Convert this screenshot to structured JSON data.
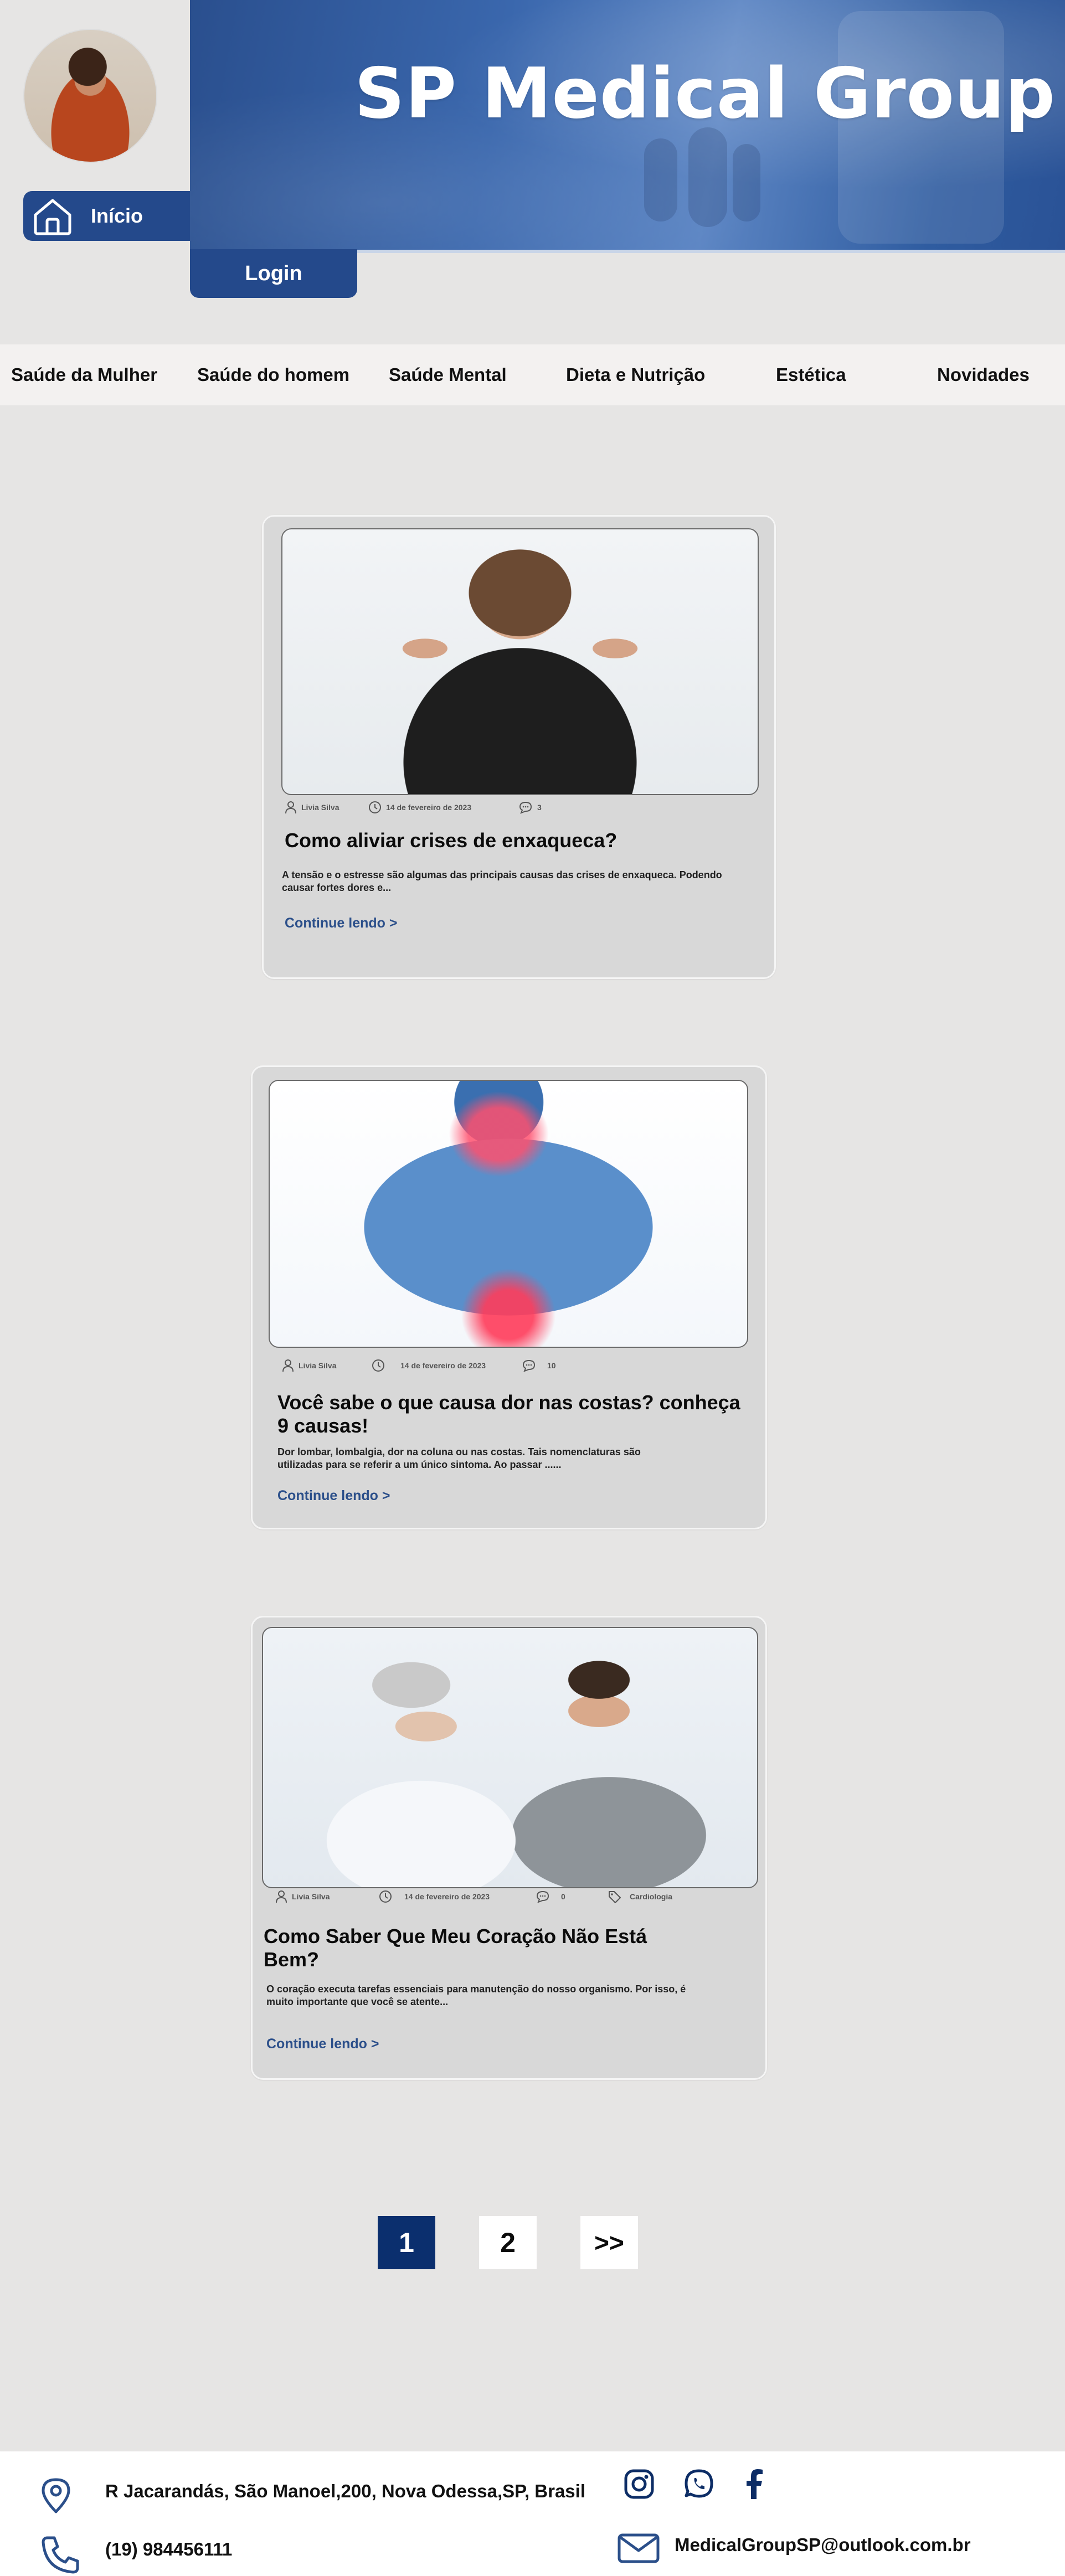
{
  "header": {
    "title": "SP Medical Group",
    "home_label": "Início",
    "login_label": "Login"
  },
  "nav": {
    "items": [
      {
        "label": "Saúde da Mulher"
      },
      {
        "label": "Saúde do homem"
      },
      {
        "label": "Saúde Mental"
      },
      {
        "label": "Dieta e Nutrição"
      },
      {
        "label": "Estética"
      },
      {
        "label": "Novidades"
      }
    ]
  },
  "posts": [
    {
      "author": "Livia Silva",
      "date": "14 de fevereiro de 2023",
      "comments": "3",
      "title": "Como aliviar crises de enxaqueca?",
      "excerpt": "A tensão e o estresse são algumas das principais causas das crises de enxaqueca. Podendo causar fortes dores e...",
      "more": "Continue lendo >"
    },
    {
      "author": "Livia Silva",
      "date": "14 de fevereiro de 2023",
      "comments": "10",
      "title": "Você sabe o que causa dor nas costas? conheça 9 causas!",
      "excerpt": "Dor lombar, lombalgia, dor na coluna ou nas costas. Tais nomenclaturas são utilizadas para se referir a um único sintoma. Ao passar ......",
      "more": "Continue lendo >"
    },
    {
      "author": "Livia Silva",
      "date": "14 de fevereiro de 2023",
      "comments": "0",
      "tag": "Cardiologia",
      "title": "Como Saber Que Meu Coração Não Está Bem?",
      "excerpt": "O coração executa tarefas essenciais para manutenção do nosso organismo. Por isso, é muito importante que você se atente...",
      "more": "Continue lendo >"
    }
  ],
  "pagination": {
    "current": "1",
    "next_page": "2",
    "next_label": ">>"
  },
  "footer": {
    "address": "R Jacarandás, São Manoel,200, Nova Odessa,SP, Brasil",
    "phone": "(19) 984456111",
    "email": "MedicalGroupSP@outlook.com.br"
  },
  "colors": {
    "brand_blue": "#24498b",
    "page_bg": "#e6e5e4",
    "card_bg": "#d8d8d8",
    "link_blue": "#2b4f8a",
    "active_page": "#0b2f6e"
  },
  "icons": [
    "home-icon",
    "user-icon",
    "clock-icon",
    "comment-icon",
    "tag-icon",
    "location-pin-icon",
    "phone-icon",
    "instagram-icon",
    "whatsapp-icon",
    "facebook-icon",
    "mail-icon"
  ]
}
